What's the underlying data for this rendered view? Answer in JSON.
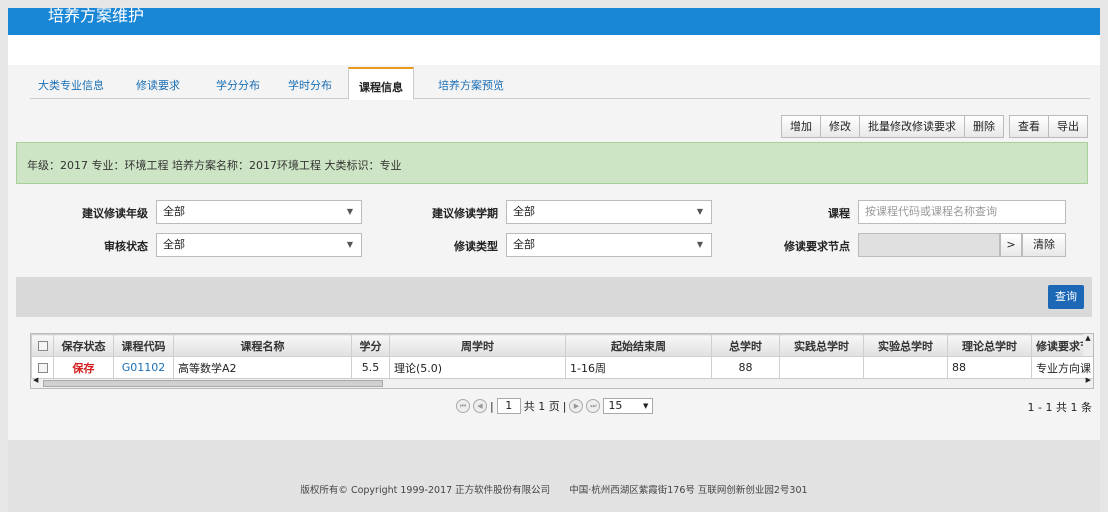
{
  "app": {
    "title": "培养方案维护"
  },
  "tabs": [
    {
      "label": "大类专业信息"
    },
    {
      "label": "修读要求"
    },
    {
      "label": "学分分布"
    },
    {
      "label": "学时分布"
    },
    {
      "label": "课程信息"
    },
    {
      "label": "培养方案预览"
    }
  ],
  "active_tab": "课程信息",
  "toolbar": {
    "add": "增加",
    "edit": "修改",
    "batch_edit": "批量修改修读要求",
    "delete": "删除",
    "view": "查看",
    "export": "导出"
  },
  "info": "年级：2017 专业：环境工程 培养方案名称：2017环境工程 大类标识：专业",
  "filters": {
    "grade_label": "建议修读年级",
    "grade_value": "全部",
    "term_label": "建议修读学期",
    "term_value": "全部",
    "course_label": "课程",
    "course_placeholder": "按课程代码或课程名称查询",
    "review_label": "审核状态",
    "review_value": "全部",
    "type_label": "修读类型",
    "type_value": "全部",
    "node_label": "修读要求节点",
    "node_go": ">",
    "clear": "清除"
  },
  "query_button": "查询",
  "table": {
    "headers": [
      "保存状态",
      "课程代码",
      "课程名称",
      "学分",
      "周学时",
      "起始结束周",
      "总学时",
      "实践总学时",
      "实验总学时",
      "理论总学时",
      "修读要求节点"
    ],
    "rows": [
      {
        "status": "保存",
        "code": "G01102",
        "name": "高等数学A2",
        "credit": "5.5",
        "weekly": "理论(5.0)",
        "weeks": "1-16周",
        "total": "88",
        "practice": "",
        "lab": "",
        "theory": "88",
        "node": "专业方向课"
      }
    ]
  },
  "pager": {
    "page": "1",
    "total_pages": "共 1 页",
    "page_size": "15",
    "summary": "1 - 1  共 1 条"
  },
  "footer": {
    "copyright": "版权所有© Copyright 1999-2017 正方软件股份有限公司",
    "address": "中国·杭州西湖区紫霞街176号 互联网创新创业园2号301"
  },
  "colors": {
    "titlebar": "#1a86d6",
    "accent_tab": "#e89a1e",
    "info_bg": "#cde5c5",
    "query_button": "#1c67b6",
    "status_red": "#d32020"
  }
}
